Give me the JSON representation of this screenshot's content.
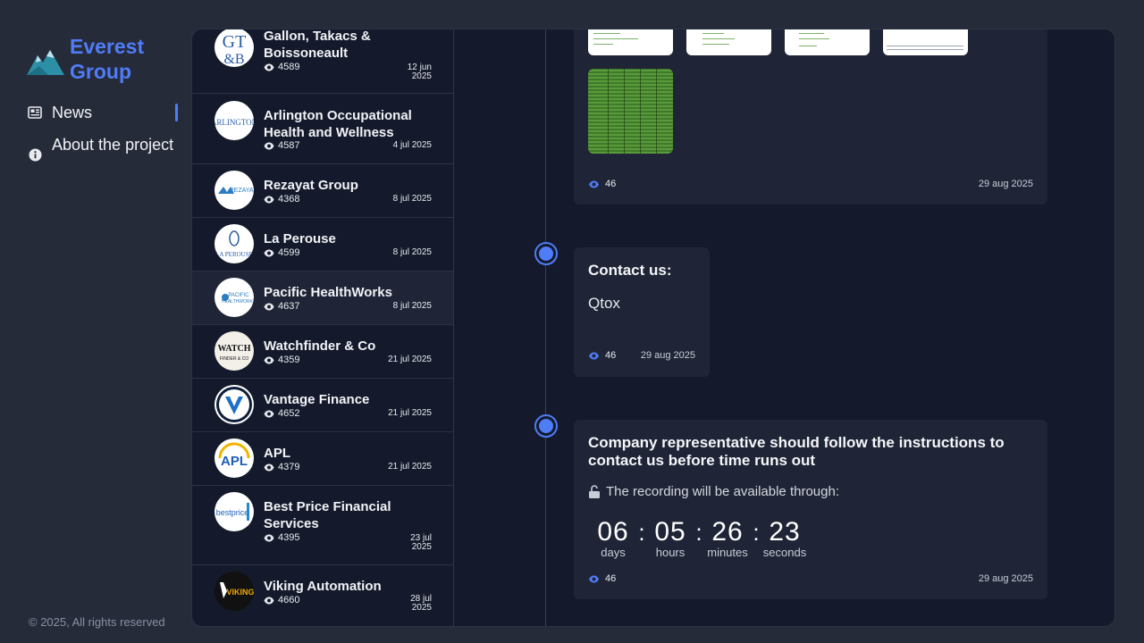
{
  "brand": {
    "name_line1": "Everest",
    "name_line2": "Group"
  },
  "nav": {
    "news": "News",
    "about": "About the project"
  },
  "footer": {
    "copyright": "© 2025, All rights reserved"
  },
  "companies": [
    {
      "name": "Gallon, Takacs & Boissoneault",
      "views": "4589",
      "date_line1": "12 jun",
      "date_line2": "2025",
      "logo_text": "GT&B"
    },
    {
      "name": "Arlington Occupational Health and Wellness",
      "views": "4587",
      "date_line1": "4 jul 2025",
      "date_line2": "",
      "logo_text": "ARLINGTON"
    },
    {
      "name": "Rezayat Group",
      "views": "4368",
      "date_line1": "8 jul 2025",
      "date_line2": "",
      "logo_text": "REZAYAT"
    },
    {
      "name": "La Perouse",
      "views": "4599",
      "date_line1": "8 jul 2025",
      "date_line2": "",
      "logo_text": "LA PEROUSE"
    },
    {
      "name": "Pacific HealthWorks",
      "views": "4637",
      "date_line1": "8 jul 2025",
      "date_line2": "",
      "logo_text": "PACIFIC"
    },
    {
      "name": "Watchfinder & Co",
      "views": "4359",
      "date_line1": "21 jul 2025",
      "date_line2": "",
      "logo_text": "WATCHFINDER"
    },
    {
      "name": "Vantage Finance",
      "views": "4652",
      "date_line1": "21 jul 2025",
      "date_line2": "",
      "logo_text": "V"
    },
    {
      "name": "APL",
      "views": "4379",
      "date_line1": "21 jul 2025",
      "date_line2": "",
      "logo_text": "APL"
    },
    {
      "name": "Best Price Financial Services",
      "views": "4395",
      "date_line1": "23 jul",
      "date_line2": "2025",
      "logo_text": "bestprice"
    },
    {
      "name": "Viking Automation",
      "views": "4660",
      "date_line1": "28 jul",
      "date_line2": "2025",
      "logo_text": "VIKING"
    }
  ],
  "posts": [
    {
      "views": "46",
      "date": "29 aug 2025"
    },
    {
      "title": "Contact us:",
      "text": "Qtox",
      "views": "46",
      "date": "29 aug 2025"
    },
    {
      "title": "Company representative should follow the instructions to contact us before time runs out",
      "recording": "The recording will be available through:",
      "countdown": [
        {
          "value": "06",
          "label": "days"
        },
        {
          "value": "05",
          "label": "hours"
        },
        {
          "value": "26",
          "label": "minutes"
        },
        {
          "value": "23",
          "label": "seconds"
        }
      ],
      "views": "46",
      "date": "29 aug 2025"
    }
  ],
  "colors": {
    "accent": "#4f7cf7",
    "panel": "#141a2b",
    "card": "#1f2536",
    "page": "#262b3a"
  }
}
